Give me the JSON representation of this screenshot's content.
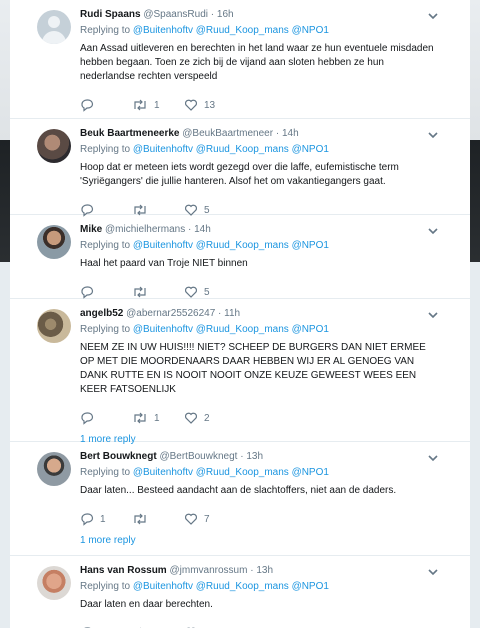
{
  "tweets": [
    {
      "avatar": "default",
      "display_name": "Rudi Spaans",
      "handle": "@SpaansRudi",
      "time": "16h",
      "replying_prefix": "Replying to",
      "mentions": [
        "@Buitenhoftv",
        "@Ruud_Koop_mans",
        "@NPO1"
      ],
      "text": "Aan Assad uitleveren en berechten in het land waar ze hun eventuele misdaden hebben begaan. Toen ze zich bij de vijand aan sloten hebben ze hun nederlandse rechten verspeeld",
      "replies": "",
      "retweets": "1",
      "likes": "13",
      "more_replies": ""
    },
    {
      "avatar": "beuk",
      "display_name": "Beuk Baartmeneerke",
      "handle": "@BeukBaartmeneer",
      "time": "14h",
      "replying_prefix": "Replying to",
      "mentions": [
        "@Buitenhoftv",
        "@Ruud_Koop_mans",
        "@NPO1"
      ],
      "text": "Hoop dat er meteen iets wordt gezegd over die laffe, eufemistische term 'Syriëgangers' die jullie hanteren. Alsof het om vakantiegangers gaat.",
      "replies": "",
      "retweets": "",
      "likes": "5",
      "more_replies": ""
    },
    {
      "avatar": "mike",
      "display_name": "Mike",
      "handle": "@michielhermans",
      "time": "14h",
      "replying_prefix": "Replying to",
      "mentions": [
        "@Buitenhoftv",
        "@Ruud_Koop_mans",
        "@NPO1"
      ],
      "text": "Haal het paard van Troje NIET binnen",
      "replies": "",
      "retweets": "",
      "likes": "5",
      "more_replies": ""
    },
    {
      "avatar": "angel",
      "display_name": "angelb52",
      "handle": "@abernar25526247",
      "time": "11h",
      "replying_prefix": "Replying to",
      "mentions": [
        "@Buitenhoftv",
        "@Ruud_Koop_mans",
        "@NPO1"
      ],
      "text": "NEEM ZE IN UW HUIS!!!! NIET? SCHEEP DE BURGERS DAN NIET ERMEE OP MET DIE MOORDENAARS DAAR HEBBEN WIJ ER AL GENOEG VAN DANK RUTTE EN IS NOOIT NOOIT ONZE KEUZE GEWEEST WEES EEN KEER FATSOENLIJK",
      "replies": "",
      "retweets": "1",
      "likes": "2",
      "more_replies": "1 more reply"
    },
    {
      "avatar": "bert",
      "display_name": "Bert Bouwknegt",
      "handle": "@BertBouwknegt",
      "time": "13h",
      "replying_prefix": "Replying to",
      "mentions": [
        "@Buitenhoftv",
        "@Ruud_Koop_mans",
        "@NPO1"
      ],
      "text": "Daar laten... Besteed aandacht aan de slachtoffers, niet aan de daders.",
      "replies": "1",
      "retweets": "",
      "likes": "7",
      "more_replies": "1 more reply"
    },
    {
      "avatar": "hans",
      "display_name": "Hans van Rossum",
      "handle": "@jmmvanrossum",
      "time": "13h",
      "replying_prefix": "Replying to",
      "mentions": [
        "@Buitenhoftv",
        "@Ruud_Koop_mans",
        "@NPO1"
      ],
      "text": "Daar laten en daar berechten.",
      "replies": "",
      "retweets": "",
      "likes": "",
      "more_replies": ""
    }
  ],
  "colors": {
    "link": "#1b95e0",
    "meta": "#657786",
    "text": "#14171a"
  },
  "icons": [
    "chevron-down-icon",
    "reply-icon",
    "retweet-icon",
    "like-icon"
  ]
}
